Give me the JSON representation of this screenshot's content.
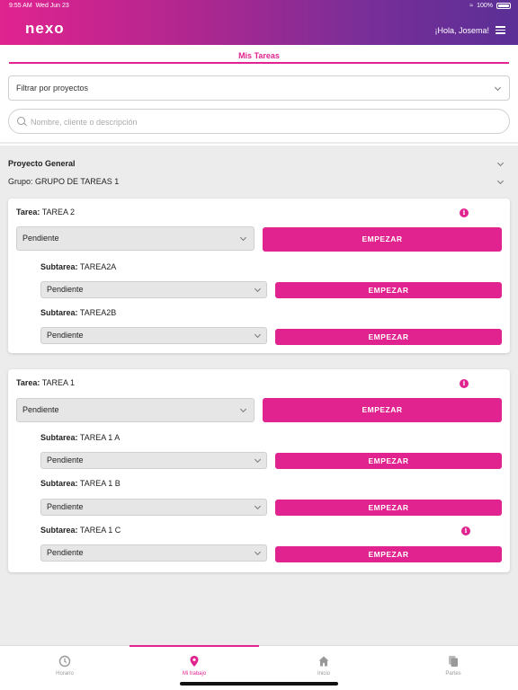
{
  "status_bar": {
    "time": "9:55 AM",
    "date": "Wed Jun 23",
    "battery": "100%"
  },
  "header": {
    "logo": "nexo",
    "greeting": "¡Hola, Josema!"
  },
  "page": {
    "title": "Mis Tareas"
  },
  "filter": {
    "project_select": "Filtrar por proyectos",
    "search_placeholder": "Nombre, cliente o descripción"
  },
  "project": {
    "name": "Proyecto General",
    "group_label": "Grupo:",
    "group_name": "GRUPO DE TAREAS 1"
  },
  "labels": {
    "task": "Tarea:",
    "subtask": "Subtarea:",
    "status": "Pendiente",
    "start": "EMPEZAR"
  },
  "tasks": [
    {
      "name": "TAREA 2",
      "subtasks": [
        "TAREA2A",
        "TAREA2B"
      ]
    },
    {
      "name": "TAREA 1",
      "subtasks": [
        "TAREA 1 A",
        "TAREA 1 B",
        "TAREA 1 C"
      ]
    }
  ],
  "nav": [
    {
      "label": "Horario",
      "icon": "clock-icon",
      "active": false
    },
    {
      "label": "Mi trabajo",
      "icon": "location-pin-icon",
      "active": true
    },
    {
      "label": "Inicio",
      "icon": "home-icon",
      "active": false
    },
    {
      "label": "Partes",
      "icon": "documents-icon",
      "active": false
    }
  ],
  "colors": {
    "accent": "#e0238f",
    "header_end": "#5a2f96"
  }
}
